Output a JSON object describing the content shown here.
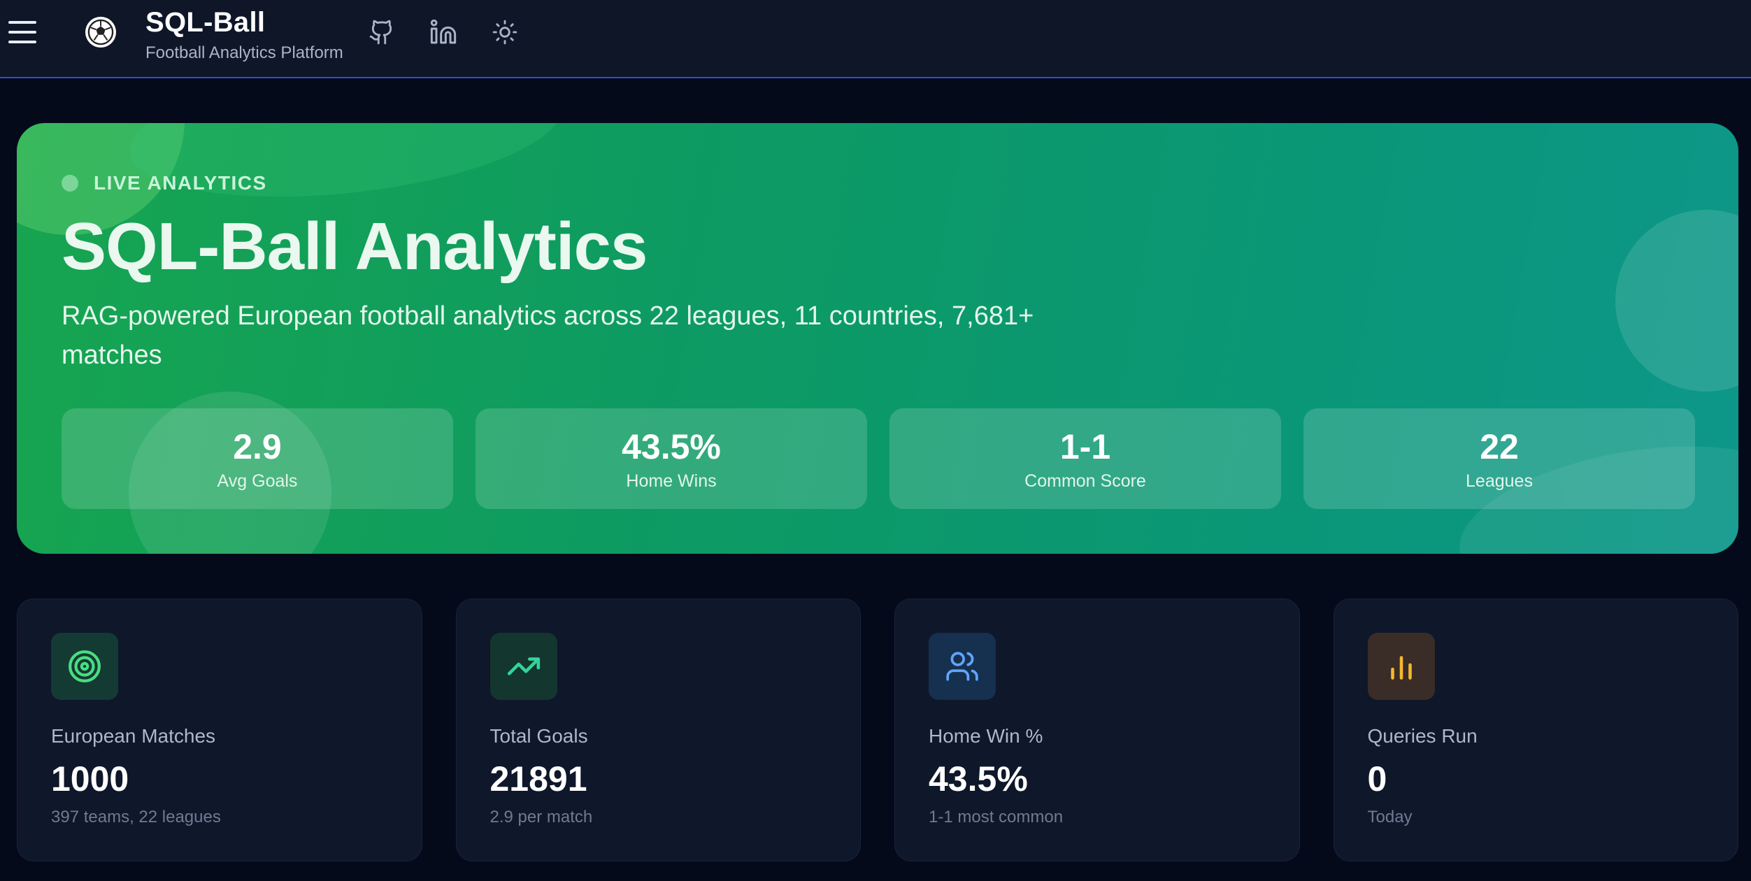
{
  "header": {
    "title": "SQL-Ball",
    "subtitle": "Football Analytics Platform",
    "icons": [
      "menu-icon",
      "football-logo-icon",
      "github-icon",
      "linkedin-icon",
      "sun-icon"
    ]
  },
  "hero": {
    "badge": "LIVE ANALYTICS",
    "title": "SQL-Ball Analytics",
    "description": "RAG-powered European football analytics across 22 leagues, 11 countries, 7,681+ matches",
    "stats": [
      {
        "value": "2.9",
        "label": "Avg Goals"
      },
      {
        "value": "43.5%",
        "label": "Home Wins"
      },
      {
        "value": "1-1",
        "label": "Common Score"
      },
      {
        "value": "22",
        "label": "Leagues"
      }
    ]
  },
  "cards": [
    {
      "icon": "target-icon",
      "label": "European Matches",
      "value": "1000",
      "note": "397 teams, 22 leagues",
      "accent": "#4ade80",
      "icon_bg": "#143a34"
    },
    {
      "icon": "trending-up-icon",
      "label": "Total Goals",
      "value": "21891",
      "note": "2.9 per match",
      "accent": "#34d399",
      "icon_bg": "#13362f"
    },
    {
      "icon": "users-icon",
      "label": "Home Win %",
      "value": "43.5%",
      "note": "1-1 most common",
      "accent": "#60a5fa",
      "icon_bg": "#16304f"
    },
    {
      "icon": "bar-chart-icon",
      "label": "Queries Run",
      "value": "0",
      "note": "Today",
      "accent": "#f5b82e",
      "icon_bg": "#3a2c26"
    }
  ],
  "colors": {
    "header_bg": "#0e1628",
    "page_bg": "#050a1a",
    "header_border": "#2d4fd6",
    "hero_gradient_start": "#17a550",
    "hero_gradient_end": "#0c978a"
  }
}
